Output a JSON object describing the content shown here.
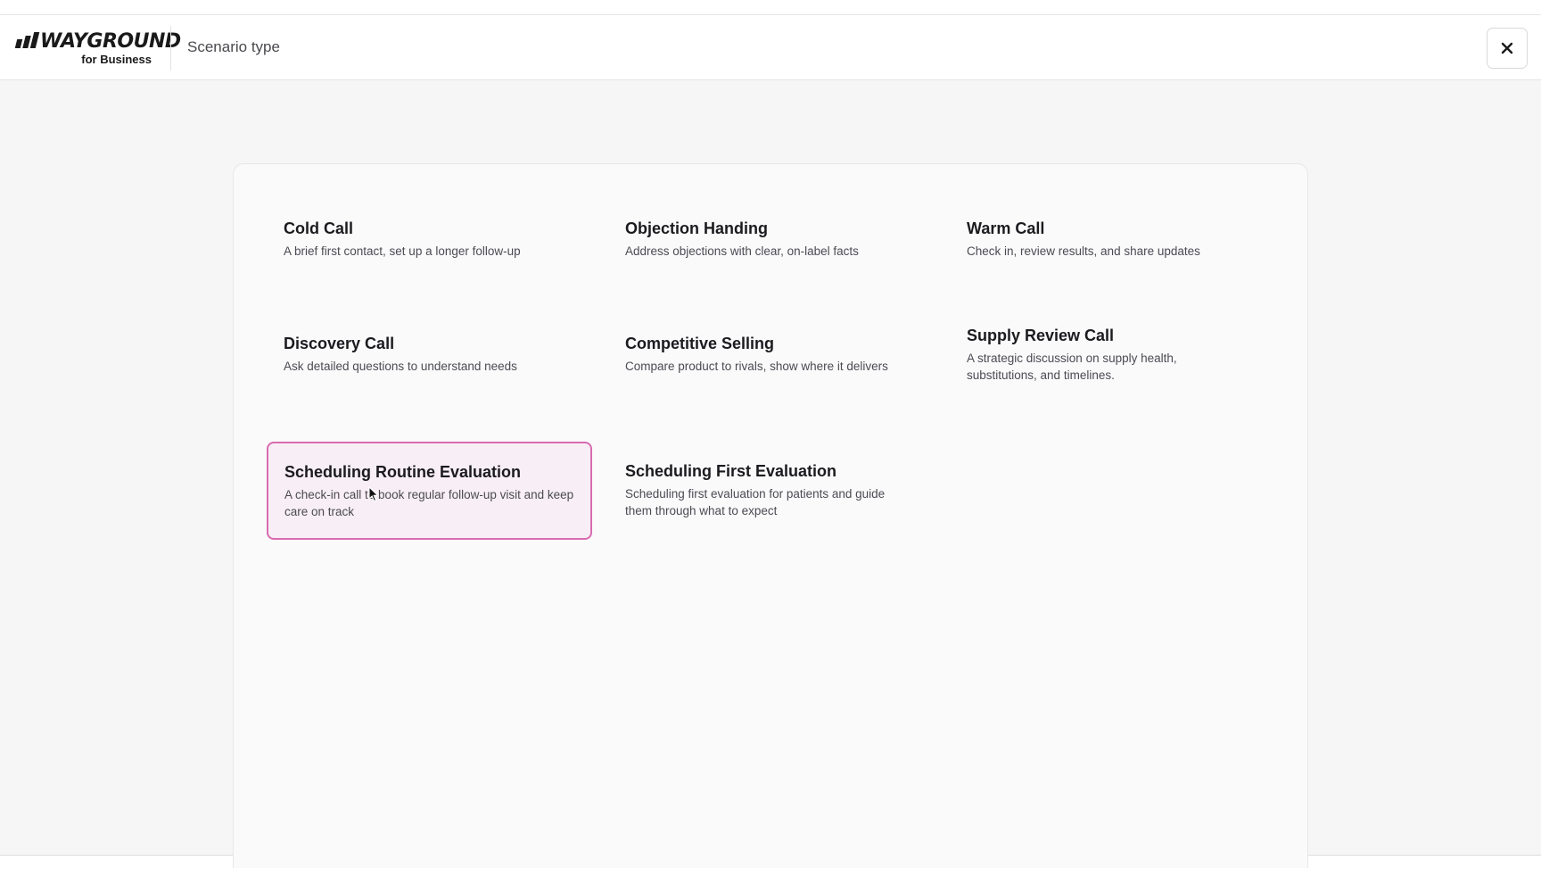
{
  "header": {
    "logo_text": "WAYGROUND",
    "logo_sub": "for Business",
    "title": "Scenario type",
    "close_icon": "close-icon"
  },
  "scenarios": [
    {
      "title": "Cold Call",
      "description": "A brief first contact, set up a longer follow-up",
      "selected": false
    },
    {
      "title": "Objection Handing",
      "description": "Address objections with clear, on-label facts",
      "selected": false
    },
    {
      "title": "Warm Call",
      "description": "Check in, review results, and share updates",
      "selected": false
    },
    {
      "title": "Discovery Call",
      "description": "Ask detailed questions to understand needs",
      "selected": false
    },
    {
      "title": "Competitive Selling",
      "description": "Compare product to rivals, show where it delivers",
      "selected": false
    },
    {
      "title": "Supply Review Call",
      "description": "A strategic discussion on supply health, substitutions, and timelines.",
      "selected": false
    },
    {
      "title": "Scheduling Routine Evaluation",
      "description": "A check-in call to book regular follow-up visit and keep care on track",
      "selected": true
    },
    {
      "title": "Scheduling First Evaluation",
      "description": "Scheduling first evaluation for patients and guide them through what to expect",
      "selected": false
    }
  ],
  "colors": {
    "selected_border": "#d96bb0",
    "selected_bg": "#f8eef5"
  }
}
